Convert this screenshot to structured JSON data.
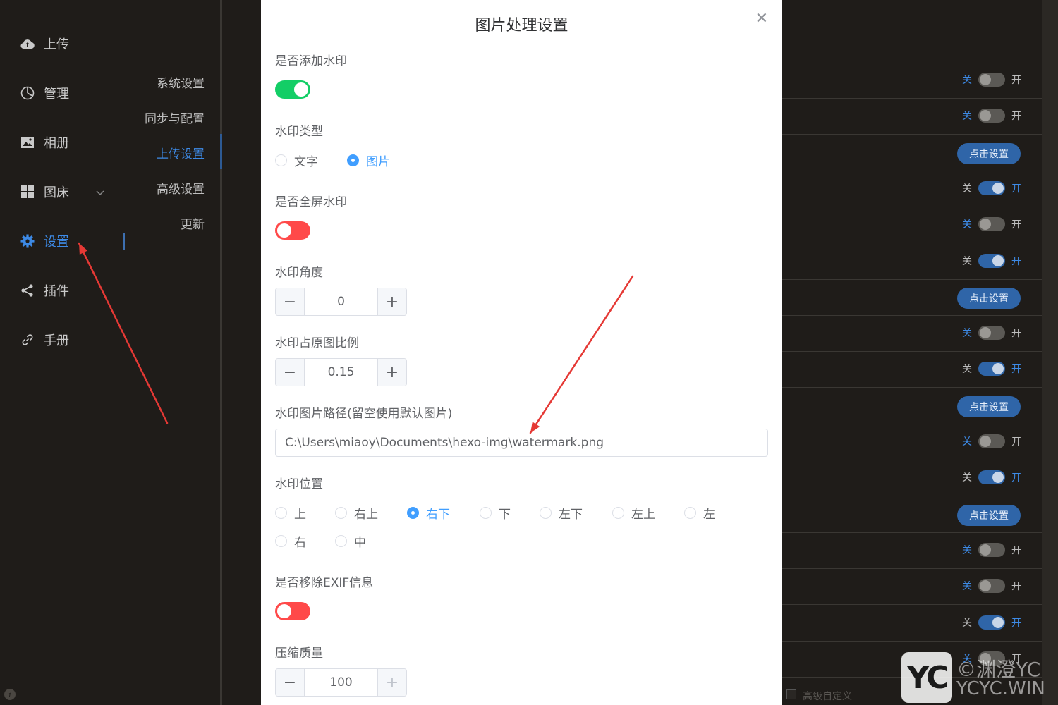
{
  "sidebar": {
    "items": [
      {
        "label": "上传",
        "icon": "upload-cloud-icon"
      },
      {
        "label": "管理",
        "icon": "pie-chart-icon"
      },
      {
        "label": "相册",
        "icon": "image-icon"
      },
      {
        "label": "图床",
        "icon": "grid-icon"
      },
      {
        "label": "设置",
        "icon": "gear-icon",
        "active": true
      },
      {
        "label": "插件",
        "icon": "share-icon"
      },
      {
        "label": "手册",
        "icon": "link-icon"
      }
    ]
  },
  "submenu": {
    "items": [
      {
        "label": "系统设置"
      },
      {
        "label": "同步与配置"
      },
      {
        "label": "上传设置",
        "active": true
      },
      {
        "label": "高级设置"
      },
      {
        "label": "更新"
      }
    ]
  },
  "right_list": {
    "off_label": "关",
    "on_label": "开",
    "button_label": "点击设置",
    "rows": [
      {
        "kind": "switch",
        "on": false
      },
      {
        "kind": "switch",
        "on": false
      },
      {
        "kind": "button"
      },
      {
        "kind": "switch",
        "on": true
      },
      {
        "kind": "switch",
        "on": false
      },
      {
        "kind": "switch",
        "on": true
      },
      {
        "kind": "button"
      },
      {
        "kind": "switch",
        "on": false
      },
      {
        "kind": "switch",
        "on": true
      },
      {
        "kind": "button"
      },
      {
        "kind": "switch",
        "on": false
      },
      {
        "kind": "switch",
        "on": true
      },
      {
        "kind": "button"
      },
      {
        "kind": "switch",
        "on": false
      },
      {
        "kind": "switch",
        "on": false
      },
      {
        "kind": "switch",
        "on": true
      },
      {
        "kind": "switch",
        "on": false
      }
    ],
    "footer_label": "高级自定义"
  },
  "modal": {
    "title": "图片处理设置",
    "add_watermark": {
      "label": "是否添加水印",
      "on": true
    },
    "watermark_type": {
      "label": "水印类型",
      "options": [
        "文字",
        "图片"
      ],
      "selected": "图片"
    },
    "fullscreen": {
      "label": "是否全屏水印",
      "on": false
    },
    "angle": {
      "label": "水印角度",
      "value": "0"
    },
    "ratio": {
      "label": "水印占原图比例",
      "value": "0.15"
    },
    "image_path": {
      "label": "水印图片路径(留空使用默认图片)",
      "value": "C:\\Users\\miaoy\\Documents\\hexo-img\\watermark.png"
    },
    "position": {
      "label": "水印位置",
      "options": [
        "上",
        "右上",
        "右下",
        "下",
        "左下",
        "左上",
        "左",
        "右",
        "中"
      ],
      "selected": "右下"
    },
    "remove_exif": {
      "label": "是否移除EXIF信息",
      "on": false
    },
    "quality": {
      "label": "压缩质量",
      "value": "100"
    }
  },
  "watermark": {
    "logo": "YC",
    "line1": "©渊澄YC",
    "line2": "YCYC.WIN"
  },
  "colors": {
    "accent": "#409eff",
    "switch_on": "#13ce66",
    "switch_off": "#ff4949",
    "annotation": "#e53935"
  }
}
